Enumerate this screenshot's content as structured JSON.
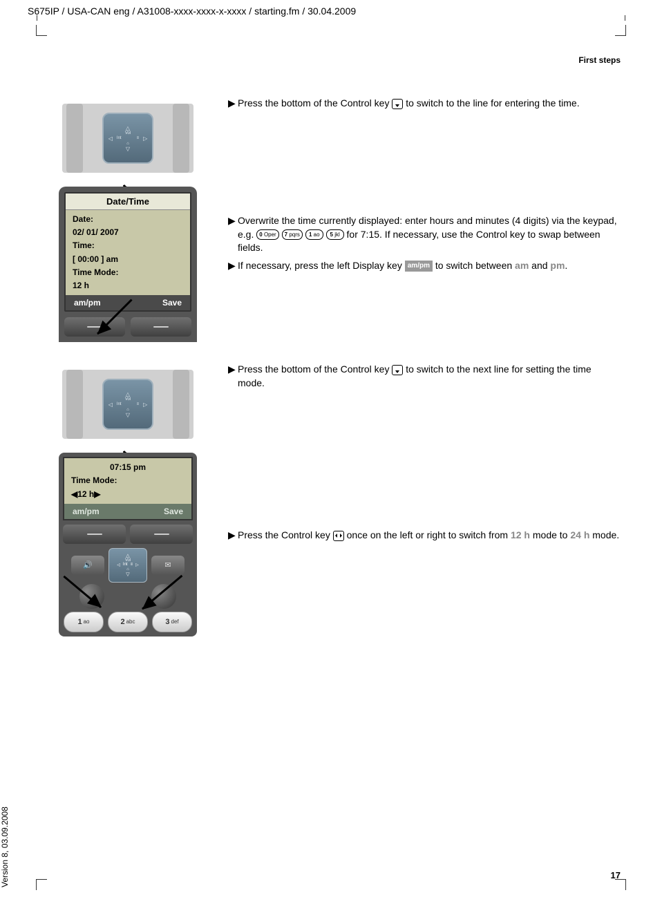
{
  "doc": {
    "header": "S675IP  / USA-CAN eng / A31008-xxxx-xxxx-x-xxxx / starting.fm / 30.04.2009",
    "running_head": "First steps",
    "page": "17",
    "version": "Version 8, 03.09.2008"
  },
  "nav_labels": {
    "vol": "Vol",
    "int": "Int"
  },
  "instr": {
    "step1": "Press the bottom of the Control key ",
    "step1b": " to switch to the line for entering the time.",
    "step2a": "Overwrite the time currently displayed: enter hours and minutes (4 digits) via the keypad, e.g. ",
    "step2b": " for 7:15. If necessary, use the Control key to swap between fields.",
    "step3a": "If necessary, press the left Display key ",
    "step3b": " to switch between ",
    "am": "am",
    "and": " and ",
    "pm": "pm",
    "period": ".",
    "step4a": "Press the bottom of the Control key ",
    "step4b": " to switch to the next line for setting the time mode.",
    "step5a": "Press the Control key ",
    "step5b": " once on the left or right to switch from ",
    "mode12": "12 h ",
    "step5c": " mode to ",
    "mode24": "24 h",
    "step5d": " mode."
  },
  "keys": {
    "k0": "0",
    "k0sub": "Oper",
    "k7": "7",
    "k7sub": "pqrs",
    "k1": "1",
    "k1sub": "ao",
    "k5": "5",
    "k5sub": "jkl",
    "soft_ampm": "am/pm"
  },
  "screen1": {
    "title": "Date/Time",
    "l1": "Date:",
    "l2": "02/ 01/ 2007",
    "l3": "Time:",
    "l4": "[ 00:00 ] am",
    "l5": "Time Mode:",
    "l6": "12 h",
    "soft_left": "am/pm",
    "soft_right": "Save"
  },
  "screen2": {
    "l1": "07:15 pm",
    "l2": "Time Mode:",
    "l3_left": "◀",
    "l3": "12 h",
    "l3_right": "▶",
    "soft_left": "am/pm",
    "soft_right": "Save"
  },
  "keypad": {
    "k1": "1",
    "k1sub": "ao",
    "k2": "2",
    "k2sub": "abc",
    "k3": "3",
    "k3sub": "def"
  }
}
